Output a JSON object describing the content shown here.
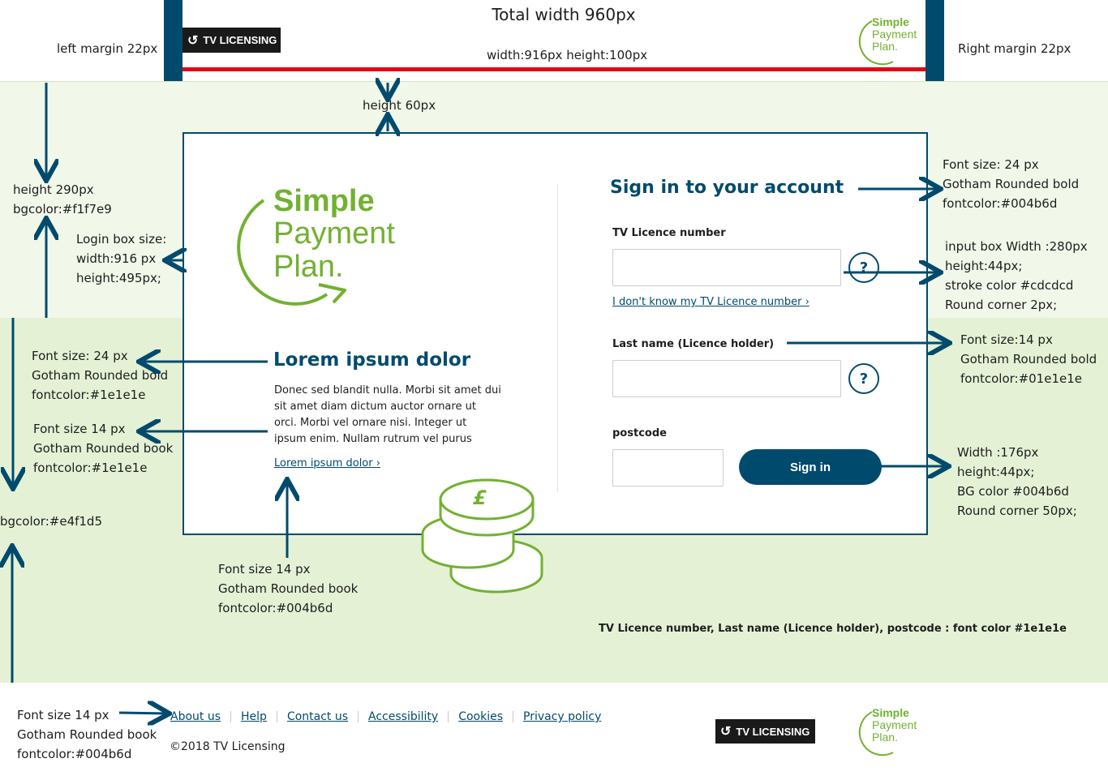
{
  "header": {
    "total_width_note": "Total width 960px",
    "left_margin_note": "left margin 22px",
    "right_margin_note": "Right margin 22px",
    "size_note": "width:916px height:100px",
    "logo_text": "TV LICENSING",
    "spp_logo": [
      "Simple",
      "Payment",
      "Plan."
    ]
  },
  "notes": {
    "height_60": "height 60px",
    "band_height": "height 290px\nbgcolor:#f1f7e9",
    "login_box_size": "Login box size:\nwidth:916 px\nheight:495px;",
    "heading_font_left": "Font size: 24 px\nGotham Rounded bold\nfontcolor:#1e1e1e",
    "body_font_left": "Font size 14 px\nGotham Rounded book\nfontcolor:#1e1e1e",
    "bg_color_2": "bgcolor:#e4f1d5",
    "link_font": "Font size 14 px\nGotham Rounded book\nfontcolor:#004b6d",
    "title_font_right": "Font size: 24 px\nGotham Rounded bold\nfontcolor:#004b6d",
    "input_box": "input box Width :280px\nheight:44px;\nstroke color #cdcdcd\nRound corner 2px;",
    "label_font_right": "Font size:14 px\nGotham Rounded bold\nfontcolor:#01e1e1e",
    "button_spec": "Width :176px\nheight:44px;\nBG color #004b6d\nRound corner 50px;",
    "label_color_note": "TV Licence number, Last name (Licence holder), postcode : font color #1e1e1e",
    "footer_font": "Font size 14 px\nGotham Rounded book\nfontcolor:#004b6d"
  },
  "login": {
    "spp_logo": [
      "Simple",
      "Payment",
      "Plan."
    ],
    "promo_heading": "Lorem ipsum dolor",
    "promo_body": "Donec sed blandit nulla. Morbi sit amet dui sit amet diam dictum auctor ornare ut orci. Morbi vel ornare nisi. Integer ut ipsum enim. Nullam rutrum vel purus",
    "promo_link": "Lorem ipsum dolor",
    "coin_symbol": "£",
    "form_title": "Sign in to your account",
    "licence_label": "TV Licence number",
    "licence_value": "",
    "forgot_link": "I don't know my TV Licence number",
    "lastname_label": "Last name (Licence holder)",
    "lastname_value": "",
    "postcode_label": "postcode",
    "postcode_value": "",
    "help_glyph": "?",
    "link_chevron": "›",
    "signin_label": "Sign in"
  },
  "footer": {
    "links": [
      "About us",
      "Help",
      "Contact us",
      "Accessibility",
      "Cookies",
      "Privacy policy"
    ],
    "copyright": "©2018 TV Licensing",
    "logo_text": "TV LICENSING",
    "spp_logo": [
      "Simple",
      "Payment",
      "Plan."
    ]
  },
  "colors": {
    "brand": "#004b6d",
    "accent_green": "#72b131",
    "band_light": "#f1f7e9",
    "band_dark": "#e4f1d5",
    "header_rule": "#e30613"
  }
}
